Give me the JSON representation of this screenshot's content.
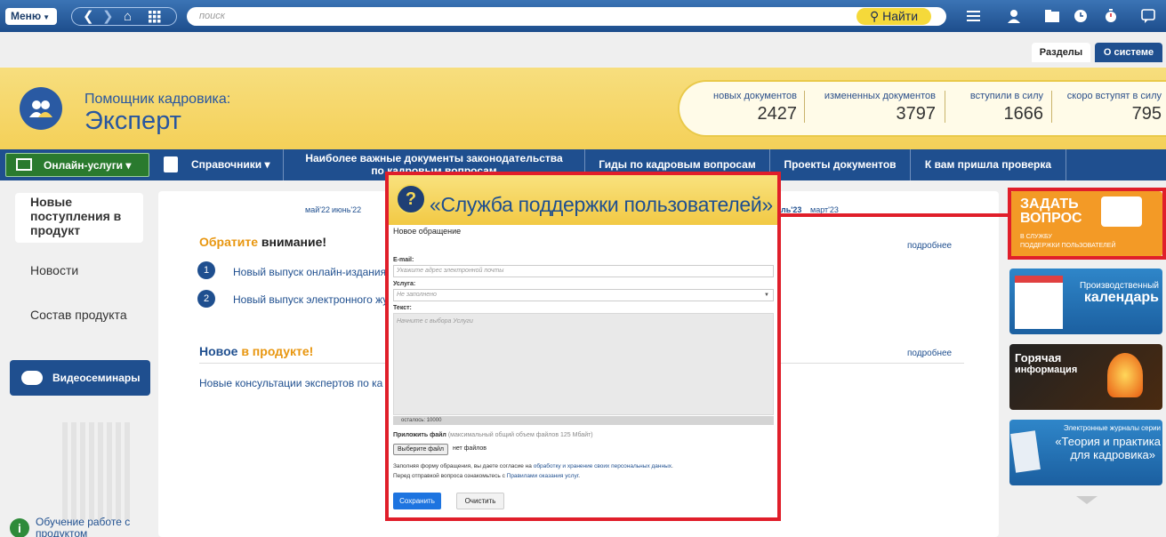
{
  "topbar": {
    "menu_label": "Меню",
    "search_placeholder": "поиск",
    "find_label": "Найти"
  },
  "tabs": [
    "Разделы",
    "О системе"
  ],
  "header": {
    "title_small": "Помощник кадровика:",
    "title_big": "Эксперт",
    "stats": [
      {
        "label": "новых документов",
        "value": "2427"
      },
      {
        "label": "измененных документов",
        "value": "3797"
      },
      {
        "label": "вступили в силу",
        "value": "1666"
      },
      {
        "label": "скоро вступят в силу",
        "value": "795"
      }
    ]
  },
  "nav": {
    "online": "Онлайн-услуги",
    "refs": "Справочники",
    "important_line1": "Наиболее важные документы законодательства",
    "important_line2": "по кадровым вопросам",
    "guides": "Гиды по кадровым вопросам",
    "projects": "Проекты документов",
    "inspection": "К вам пришла проверка"
  },
  "sidebar": {
    "new_arrivals": "Новые поступления в продукт",
    "news": "Новости",
    "composition": "Состав продукта",
    "video": "Видеосеминары",
    "training": "Обучение работе с продуктом"
  },
  "main": {
    "months_left": [
      "май'22",
      "июнь'22"
    ],
    "months_right": [
      "ль'23",
      "март'23"
    ],
    "attention_1": "Обратите",
    "attention_2": "внимание!",
    "more_1": "подробнее",
    "item1_num": "1",
    "item1_text": "Новый выпуск онлайн-издания",
    "item2_num": "2",
    "item2_text": "Новый выпуск электронного жу",
    "new_1": "Новое",
    "new_2": "в продукте!",
    "more_2": "подробнее",
    "new_text": "Новые консультации экспертов по ка"
  },
  "right": {
    "ask_line1": "ЗАДАТЬ",
    "ask_line2": "ВОПРОС",
    "ask_sub1": "В СЛУЖБУ",
    "ask_sub2": "ПОДДЕРЖКИ ПОЛЬЗОВАТЕЛЕЙ",
    "calendar_1": "Производственный",
    "calendar_2": "календарь",
    "hot_1": "Горячая",
    "hot_2": "информация",
    "journal_1": "Электронные журналы серии",
    "journal_2": "«Теория и практика",
    "journal_3": "для кадровика»"
  },
  "modal": {
    "title": "«Служба поддержки пользователей»",
    "subtitle": "Новое обращение",
    "email_label": "E-mail:",
    "email_placeholder": "Укажите адрес электронной почты",
    "service_label": "Услуга:",
    "service_value": "Не заполнено",
    "text_label": "Текст:",
    "text_placeholder": "Начните с выбора Услуги",
    "remaining": "осталось: 10000",
    "attach_label": "Приложить файл",
    "attach_hint": "(максимальный общий объем файлов 125 Мбайт)",
    "choose_file": "Выберите файл",
    "no_files": "нет файлов",
    "consent_1": "Заполняя форму обращения, вы даете согласие на",
    "consent_link": "обработку и хранение своих персональных данных",
    "consent_2": "Перед отправкой вопроса ознакомьтесь с",
    "rules_link": "Правилами оказания услуг",
    "save": "Сохранить",
    "clear": "Очистить"
  }
}
